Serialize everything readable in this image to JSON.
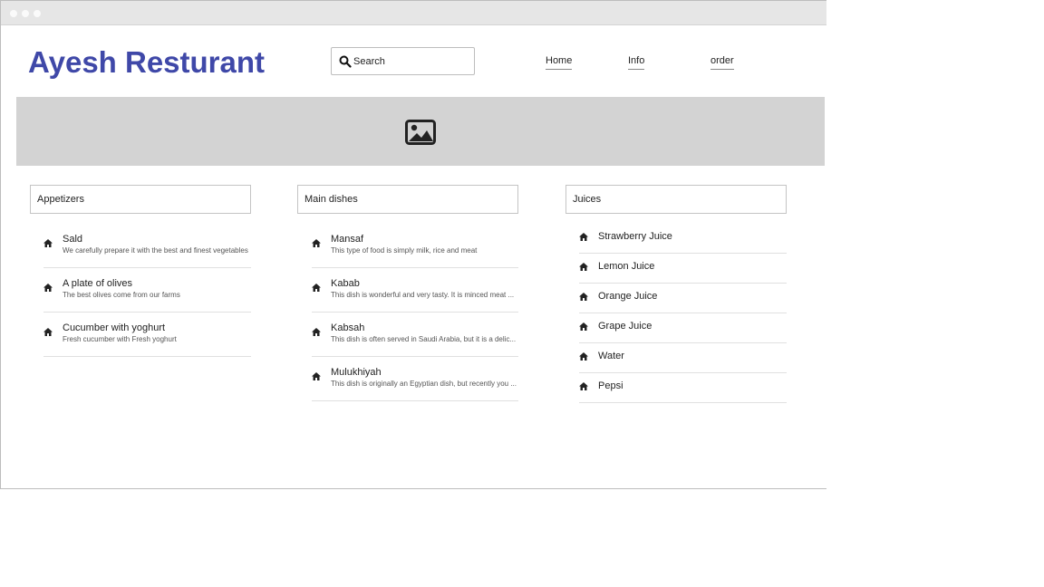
{
  "site": {
    "title": "Ayesh Resturant"
  },
  "search": {
    "placeholder": "Search"
  },
  "nav": {
    "home": "Home",
    "info": "Info",
    "order": "order"
  },
  "icons": {
    "search": "search-icon",
    "hero": "image-icon",
    "list": "home-icon"
  },
  "colors": {
    "title": "#3f48a8",
    "hero_bg": "#d3d3d3"
  },
  "sections": {
    "appetizers": {
      "title": "Appetizers",
      "items": [
        {
          "name": "Sald",
          "desc": "We carefully prepare it with the best and finest vegetables"
        },
        {
          "name": "A plate of olives",
          "desc": "The best olives come from our farms"
        },
        {
          "name": "Cucumber with yoghurt",
          "desc": "Fresh cucumber with Fresh yoghurt"
        }
      ]
    },
    "main": {
      "title": "Main dishes",
      "items": [
        {
          "name": "Mansaf",
          "desc": "This type of food is simply milk, rice and meat"
        },
        {
          "name": "Kabab",
          "desc": "This dish is wonderful and very tasty. It is minced meat ..."
        },
        {
          "name": "Kabsah",
          "desc": "This dish is often served in Saudi Arabia, but it is a delic..."
        },
        {
          "name": "Mulukhiyah",
          "desc": "This dish is originally an Egyptian dish, but recently you ..."
        }
      ]
    },
    "juices": {
      "title": "Juices",
      "items": [
        {
          "name": "Strawberry Juice"
        },
        {
          "name": "Lemon Juice"
        },
        {
          "name": "Orange Juice"
        },
        {
          "name": "Grape Juice"
        },
        {
          "name": "Water"
        },
        {
          "name": "Pepsi"
        }
      ]
    }
  }
}
